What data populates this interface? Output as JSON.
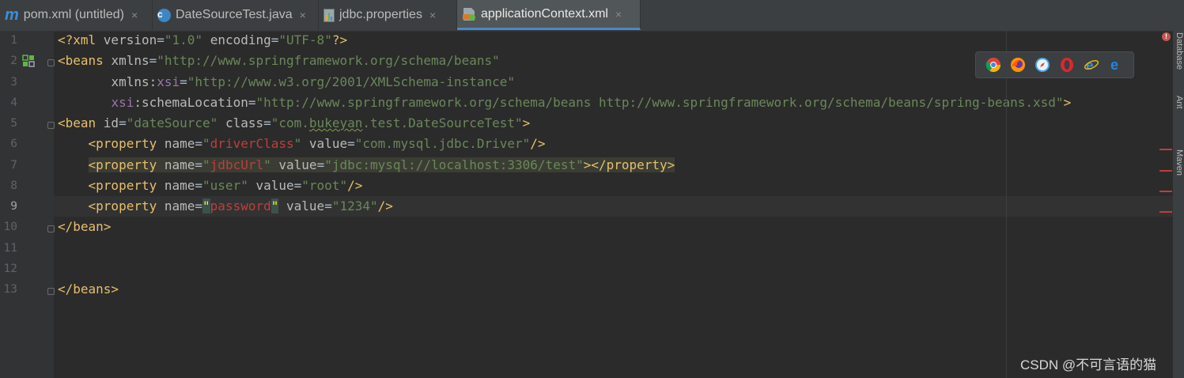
{
  "tabs": [
    {
      "label": "pom.xml (untitled)",
      "icon": "maven-m-icon"
    },
    {
      "label": "DateSourceTest.java",
      "icon": "java-class-icon"
    },
    {
      "label": "jdbc.properties",
      "icon": "properties-file-icon"
    },
    {
      "label": "applicationContext.xml",
      "icon": "xml-spring-icon",
      "active": true
    }
  ],
  "tab_close_glyph": "×",
  "line_numbers": [
    "1",
    "2",
    "3",
    "4",
    "5",
    "6",
    "7",
    "8",
    "9",
    "10",
    "11",
    "12",
    "13"
  ],
  "current_line": "9",
  "code": {
    "l1": {
      "open": "<?xml ",
      "attr1": "version",
      "eq1": "=",
      "val1": "\"1.0\"",
      "sp": " ",
      "attr2": "encoding",
      "eq2": "=",
      "val2": "\"UTF-8\"",
      "close": "?>"
    },
    "l2": {
      "open": "<beans ",
      "attr": "xmlns",
      "eq": "=",
      "val": "\"http://www.springframework.org/schema/beans\""
    },
    "l3": {
      "indent": "       ",
      "attr": "xmlns:",
      "ns": "xsi",
      "eq": "=",
      "val": "\"http://www.w3.org/2001/XMLSchema-instance\""
    },
    "l4": {
      "indent": "       ",
      "ns": "xsi",
      "attr": ":schemaLocation",
      "eq": "=",
      "val": "\"http://www.springframework.org/schema/beans http://www.springframework.org/schema/beans/spring-beans.xsd\"",
      "close": ">"
    },
    "l5": {
      "open": "<bean ",
      "attr1": "id",
      "eq1": "=",
      "val1": "\"dateSource\"",
      "sp": " ",
      "attr2": "class",
      "eq2": "=",
      "val2a": "\"com.",
      "val2b": "bukeyan",
      "val2c": ".test.DateSourceTest\"",
      "close": ">"
    },
    "l6": {
      "indent": "    ",
      "open": "<property ",
      "attr1": "name",
      "eq1": "=",
      "q1": "\"",
      "val1": "driverClass",
      "q2": "\"",
      "sp": " ",
      "attr2": "value",
      "eq2": "=",
      "val2": "\"com.mysql.jdbc.Driver\"",
      "close": "/>"
    },
    "l7": {
      "indent": "    ",
      "open": "<property ",
      "attr1": "name",
      "eq1": "=",
      "q1": "\"",
      "val1": "jdbcUrl",
      "q2": "\"",
      "sp": " ",
      "attr2": "value",
      "eq2": "=",
      "val2": "\"jdbc:mysql://localhost:3306/test\"",
      "close": "></property>"
    },
    "l8": {
      "indent": "    ",
      "open": "<property ",
      "attr1": "name",
      "eq1": "=",
      "val1": "\"user\"",
      "sp": " ",
      "attr2": "value",
      "eq2": "=",
      "val2": "\"root\"",
      "close": "/>"
    },
    "l9": {
      "indent": "    ",
      "open": "<property ",
      "attr1": "name",
      "eq1": "=",
      "q1": "\"",
      "val1": "password",
      "q2": "\"",
      "sp": " ",
      "attr2": "value",
      "eq2": "=",
      "val2": "\"1234\"",
      "close": "/>"
    },
    "l10": {
      "close": "</bean>"
    },
    "l13": {
      "close": "</beans>"
    }
  },
  "browsers": [
    "chrome-icon",
    "firefox-icon",
    "safari-icon",
    "opera-icon",
    "ie-icon",
    "edge-icon"
  ],
  "right_tools": [
    "Database",
    "Ant",
    "Maven"
  ],
  "error_indicator": "!",
  "watermark": "CSDN @不可言语的猫",
  "colors": {
    "background": "#2b2b2b",
    "tag": "#e8bf6a",
    "attribute": "#bababa",
    "value": "#6a8759",
    "error": "#bc3f3c",
    "accent": "#4a88c7"
  }
}
